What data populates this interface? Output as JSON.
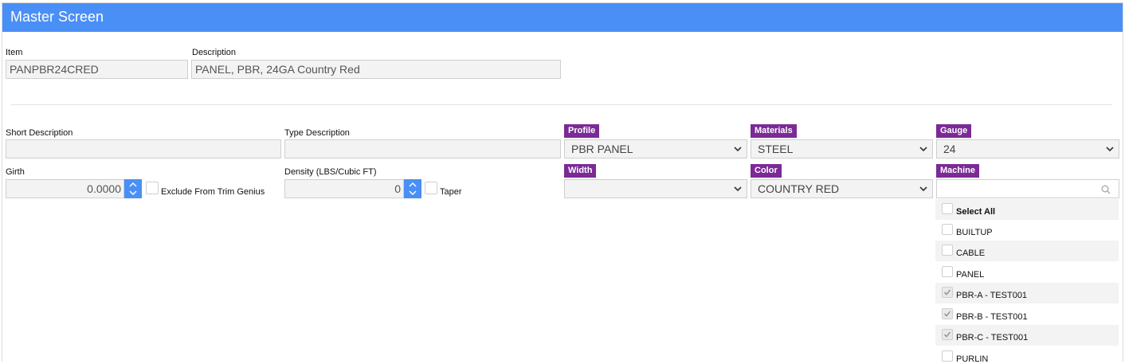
{
  "window": {
    "title": "Master Screen"
  },
  "item": {
    "label": "Item",
    "value": "PANPBR24CRED"
  },
  "description": {
    "label": "Description",
    "value": "PANEL, PBR, 24GA Country Red"
  },
  "short_description": {
    "label": "Short Description",
    "value": ""
  },
  "type_description": {
    "label": "Type Description",
    "value": ""
  },
  "profile": {
    "label": "Profile",
    "value": "PBR PANEL"
  },
  "materials": {
    "label": "Materials",
    "value": "STEEL"
  },
  "gauge": {
    "label": "Gauge",
    "value": "24"
  },
  "girth": {
    "label": "Girth",
    "value": "0.0000"
  },
  "exclude_trim": {
    "label": "Exclude From Trim Genius",
    "checked": false
  },
  "density": {
    "label": "Density (LBS/Cubic FT)",
    "value": "0"
  },
  "taper": {
    "label": "Taper",
    "checked": false
  },
  "width": {
    "label": "Width",
    "value": ""
  },
  "color": {
    "label": "Color",
    "value": "COUNTRY RED"
  },
  "machine": {
    "label": "Machine",
    "search_value": "",
    "select_all_label": "Select All",
    "items": [
      {
        "label": "BUILTUP",
        "checked": false
      },
      {
        "label": "CABLE",
        "checked": false
      },
      {
        "label": "PANEL",
        "checked": false
      },
      {
        "label": "PBR-A - TEST001",
        "checked": true
      },
      {
        "label": "PBR-B - TEST001",
        "checked": true
      },
      {
        "label": "PBR-C - TEST001",
        "checked": true
      },
      {
        "label": "PURLIN",
        "checked": false
      }
    ]
  },
  "colors": {
    "header": "#4a8ff5",
    "tag": "#7b2a96"
  }
}
